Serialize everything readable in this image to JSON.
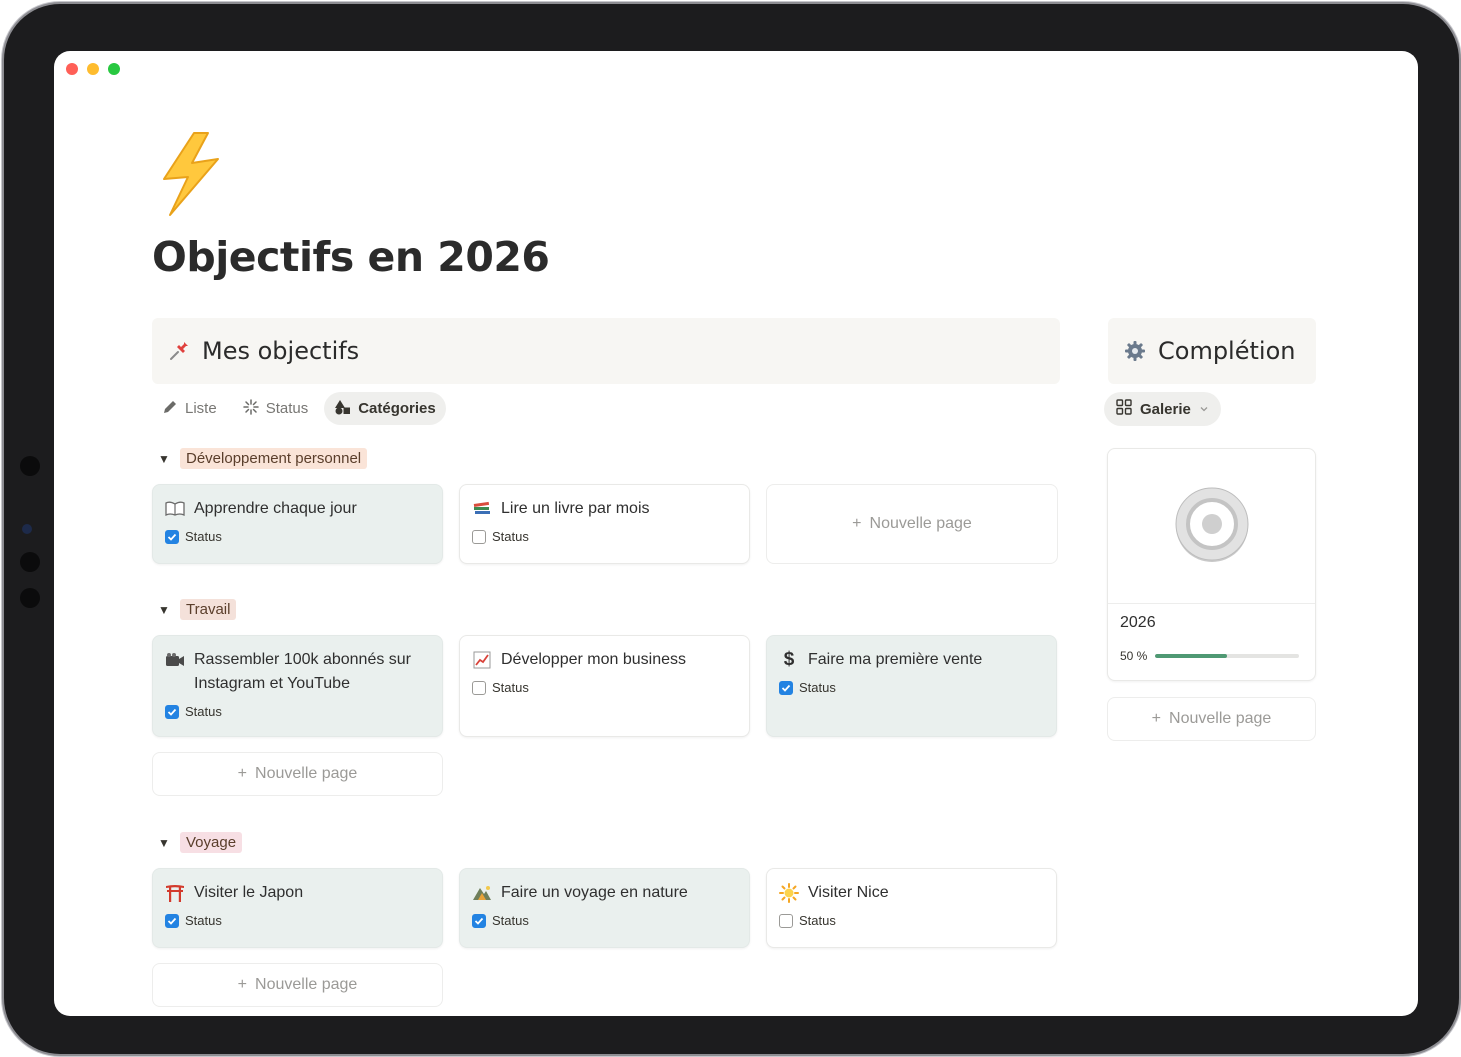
{
  "page": {
    "icon": "lightning-icon",
    "title": "Objectifs en 2026"
  },
  "objectives": {
    "heading_icon": "pushpin-icon",
    "heading": "Mes objectifs",
    "tabs": [
      {
        "label": "Liste",
        "icon": "pencil-icon",
        "active": false
      },
      {
        "label": "Status",
        "icon": "sparkle-loading-icon",
        "active": false
      },
      {
        "label": "Catégories",
        "icon": "shapes-icon",
        "active": true
      }
    ],
    "new_page_label": "Nouvelle page",
    "groups": [
      {
        "name": "Développement personnel",
        "color": "#fae4d8",
        "cards": [
          {
            "title": "Apprendre chaque jour",
            "icon": "open-book-icon",
            "status_label": "Status",
            "done": true
          },
          {
            "title": "Lire un livre par mois",
            "icon": "books-icon",
            "status_label": "Status",
            "done": false
          }
        ]
      },
      {
        "name": "Travail",
        "color": "#f4e1da",
        "cards": [
          {
            "title": "Rassembler 100k abonnés sur Instagram et YouTube",
            "icon": "video-camera-icon",
            "status_label": "Status",
            "done": true
          },
          {
            "title": "Développer mon business",
            "icon": "chart-up-icon",
            "status_label": "Status",
            "done": false
          },
          {
            "title": "Faire ma première vente",
            "icon": "dollar-icon",
            "status_label": "Status",
            "done": true
          }
        ]
      },
      {
        "name": "Voyage",
        "color": "#f7dfe4",
        "cards": [
          {
            "title": "Visiter le Japon",
            "icon": "torii-icon",
            "status_label": "Status",
            "done": true
          },
          {
            "title": "Faire un voyage en nature",
            "icon": "camping-icon",
            "status_label": "Status",
            "done": true
          },
          {
            "title": "Visiter Nice",
            "icon": "sun-icon",
            "status_label": "Status",
            "done": false
          }
        ]
      }
    ]
  },
  "completion": {
    "heading_icon": "gear-icon",
    "heading": "Complétion",
    "view_label": "Galerie",
    "card": {
      "name": "2026",
      "progress_label": "50 %",
      "progress": 0.5
    },
    "new_page_label": "Nouvelle page"
  },
  "colors": {
    "check": "#2383e2",
    "done_card": "#eaf0ee",
    "progress": "#4f9973"
  }
}
